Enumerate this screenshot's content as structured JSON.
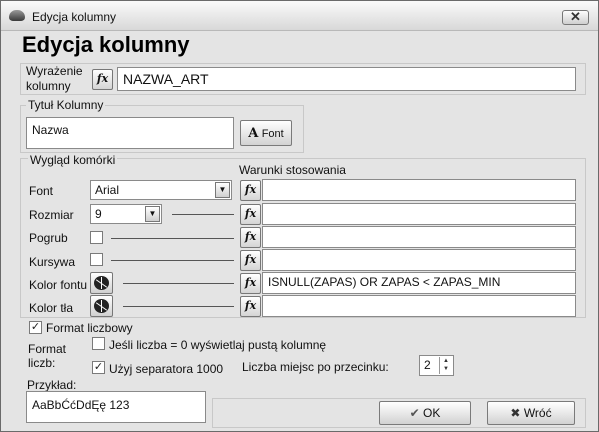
{
  "window": {
    "title": "Edycja kolumny",
    "close_glyph": "✕"
  },
  "heading": "Edycja kolumny",
  "expression": {
    "label_line1": "Wyrażenie",
    "label_line2": "kolumny",
    "fx_label": "fx",
    "value": "NAZWA_ART"
  },
  "column_title": {
    "label": "Tytuł Kolumny",
    "value": "Nazwa",
    "font_button_label": "Font",
    "font_button_icon": "A"
  },
  "cell_look": {
    "label": "Wygląd komórki",
    "conditions_header": "Warunki stosowania",
    "font": {
      "label": "Font",
      "value": "Arial",
      "condition": ""
    },
    "size": {
      "label": "Rozmiar",
      "value": "9",
      "condition": ""
    },
    "bold": {
      "label": "Pogrub",
      "checked": false,
      "condition": ""
    },
    "italic": {
      "label": "Kursywa",
      "checked": false,
      "condition": ""
    },
    "font_color": {
      "label": "Kolor fontu",
      "condition": "ISNULL(ZAPAS) OR ZAPAS < ZAPAS_MIN"
    },
    "bg_color": {
      "label": "Kolor tła",
      "condition": ""
    }
  },
  "number_format": {
    "toggle_label": "Format liczbowy",
    "toggle_checked": true,
    "format_label_line1": "Format",
    "format_label_line2": "liczb:",
    "zero_empty_label": "Jeśli liczba = 0 wyświetlaj  pustą kolumnę",
    "zero_empty_checked": false,
    "separator_label": "Użyj separatora 1000",
    "separator_checked": true,
    "decimals_label": "Liczba miejsc po przecinku:",
    "decimals_value": "2"
  },
  "example": {
    "label": "Przykład:",
    "value": "AaBbĆćDdĘę 123"
  },
  "buttons": {
    "ok_label": "OK",
    "ok_icon": "✔",
    "cancel_label": "Wróć",
    "cancel_icon": "✖"
  },
  "icons": {
    "check_glyph": "✓",
    "combo_arrow": "▼",
    "spin_up": "▲",
    "spin_down": "▼"
  }
}
